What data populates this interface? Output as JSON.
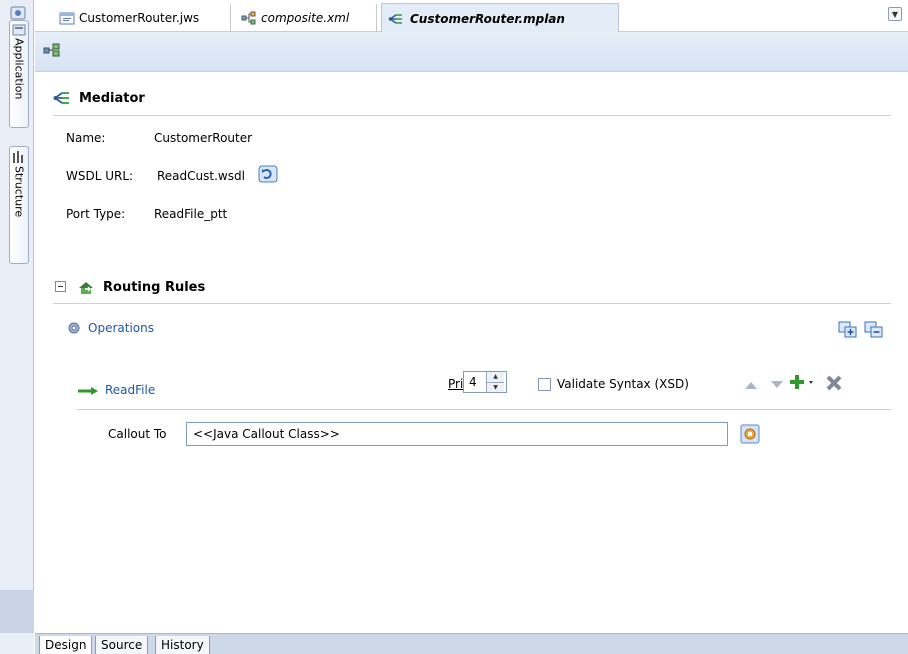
{
  "dock": {
    "application_label": "Application",
    "structure_label": "Structure"
  },
  "editor_tabs": [
    {
      "label": "CustomerRouter.jws",
      "icon": "project-icon"
    },
    {
      "label": "composite.xml",
      "icon": "composite-icon"
    },
    {
      "label": "CustomerRouter.mplan",
      "icon": "mediator-icon",
      "active": true
    }
  ],
  "mediator": {
    "title": "Mediator",
    "name_label": "Name:",
    "name_value": "CustomerRouter",
    "wsdl_label": "WSDL URL:",
    "wsdl_value": "ReadCust.wsdl",
    "port_label": "Port Type:",
    "port_value": "ReadFile_ptt"
  },
  "routing": {
    "title": "Routing Rules",
    "operations_label": "Operations",
    "operation_name": "ReadFile",
    "priority_label": "Priority",
    "priority_value": "4",
    "validate_label": "Validate Syntax (XSD)",
    "validate_checked": false,
    "callout_label": "Callout To",
    "callout_value": "<<Java Callout Class>>"
  },
  "bottom_tabs": [
    "Design",
    "Source",
    "History"
  ],
  "colors": {
    "link": "#1f57a8",
    "accent_green": "#2e9a2e",
    "toolbar_bg": "#dbe6f4"
  }
}
